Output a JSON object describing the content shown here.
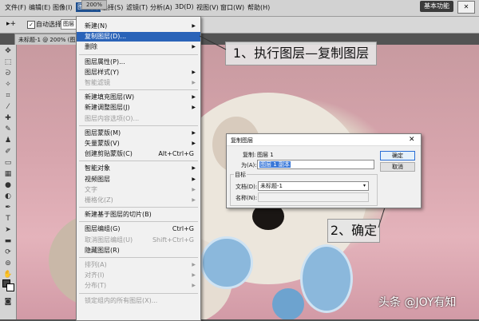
{
  "menubar": {
    "items": [
      "文件(F)",
      "编辑(E)",
      "图像(I)",
      "图层(L)",
      "选择(S)",
      "滤镜(T)",
      "分析(A)",
      "3D(D)",
      "视图(V)",
      "窗口(W)",
      "帮助(H)"
    ],
    "zoom": "200%",
    "workspace": "基本功能"
  },
  "options_bar": {
    "auto_select_label": "自动选择:",
    "auto_select_value": "图层"
  },
  "doc_tab": "未标题-1 @ 200% (图层",
  "layer_menu": {
    "items": [
      {
        "label": "新建(N)",
        "submenu": true
      },
      {
        "label": "复制图层(D)...",
        "highlighted": true
      },
      {
        "label": "删除",
        "submenu": true
      },
      {
        "label": "图层属性(P)..."
      },
      {
        "label": "图层样式(Y)",
        "submenu": true
      },
      {
        "label": "智能滤镜",
        "disabled": true,
        "submenu": true
      },
      {
        "label": "新建填充图层(W)",
        "submenu": true
      },
      {
        "label": "新建调整图层(J)",
        "submenu": true
      },
      {
        "label": "图层内容选项(O)...",
        "disabled": true
      },
      {
        "label": "图层蒙版(M)",
        "submenu": true
      },
      {
        "label": "矢量蒙版(V)",
        "submenu": true
      },
      {
        "label": "创建剪贴蒙版(C)",
        "shortcut": "Alt+Ctrl+G"
      },
      {
        "label": "智能对象",
        "submenu": true
      },
      {
        "label": "视频图层",
        "submenu": true
      },
      {
        "label": "文字",
        "disabled": true,
        "submenu": true
      },
      {
        "label": "栅格化(Z)",
        "disabled": true,
        "submenu": true
      },
      {
        "label": "新建基于图层的切片(B)"
      },
      {
        "label": "图层编组(G)",
        "shortcut": "Ctrl+G"
      },
      {
        "label": "取消图层编组(U)",
        "shortcut": "Shift+Ctrl+G",
        "disabled": true
      },
      {
        "label": "隐藏图层(R)"
      },
      {
        "label": "排列(A)",
        "disabled": true,
        "submenu": true
      },
      {
        "label": "对齐(I)",
        "disabled": true,
        "submenu": true
      },
      {
        "label": "分布(T)",
        "disabled": true,
        "submenu": true
      },
      {
        "label": "锁定组内的所有图层(X)...",
        "disabled": true
      }
    ]
  },
  "annotations": {
    "step1": "1、执行图层—复制图层",
    "step2": "2、确定",
    "watermark": "头条 @JOY有知"
  },
  "dialog": {
    "title": "复制图层",
    "copy_label": "复制:",
    "copy_value": "图层 1",
    "as_label": "为(A):",
    "as_value": "图层 1 副本",
    "target_label": "目标",
    "doc_label": "文档(D):",
    "doc_value": "未标题-1",
    "name_label": "名称(N):",
    "ok": "确定",
    "cancel": "取消"
  }
}
